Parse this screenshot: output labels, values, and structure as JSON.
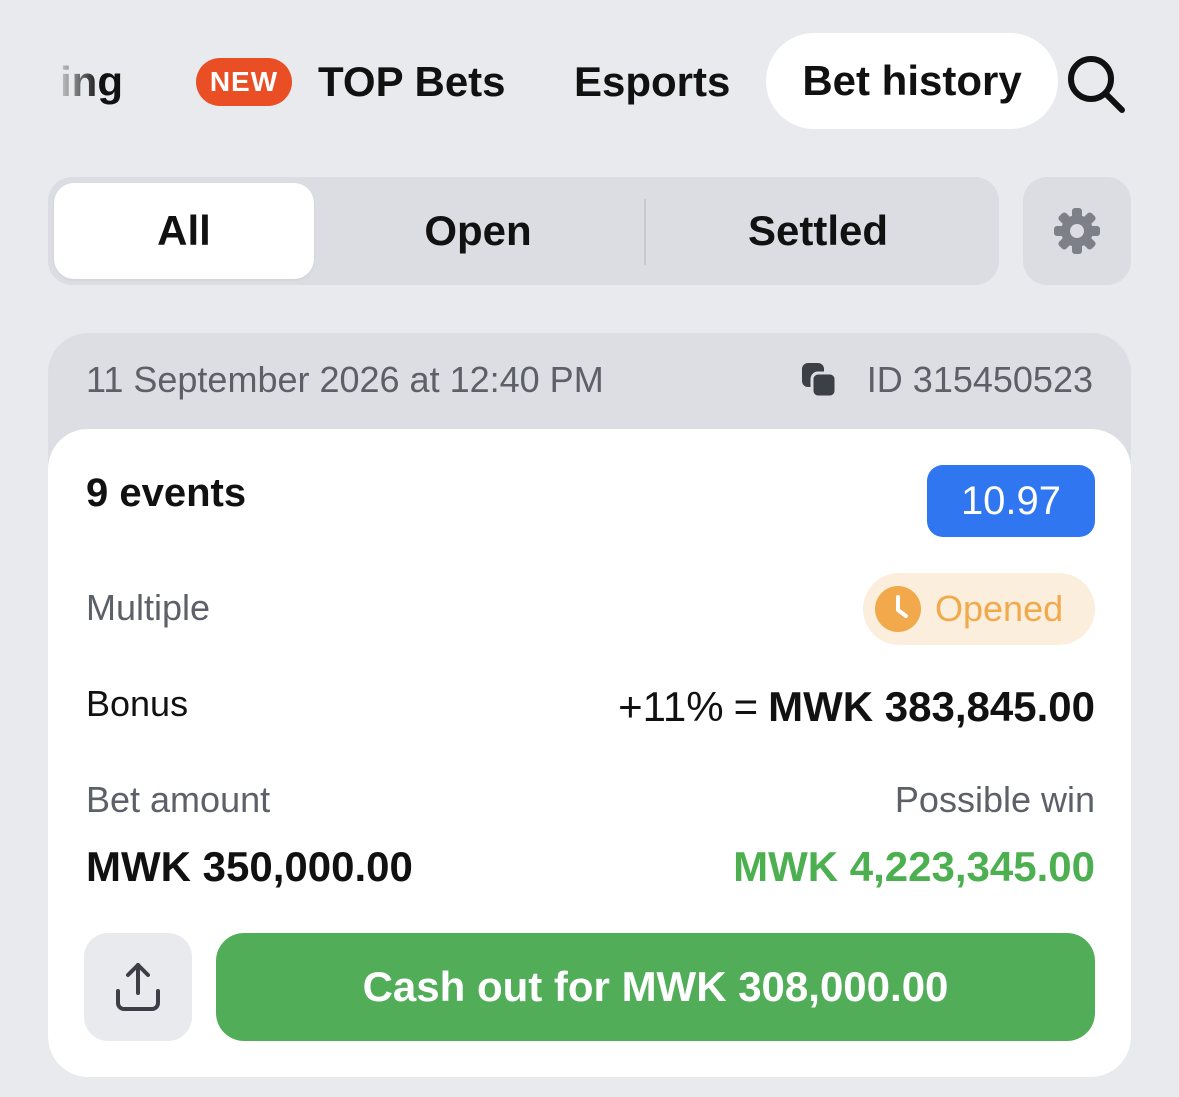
{
  "nav": {
    "partial_label": "ing",
    "new_badge": "NEW",
    "top_bets": "TOP Bets",
    "esports": "Esports",
    "bet_history": "Bet history"
  },
  "filters": {
    "all": "All",
    "open": "Open",
    "settled": "Settled",
    "selected": "All"
  },
  "bet": {
    "date": "11 September 2026 at 12:40 PM",
    "id": "ID 315450523",
    "events": "9 events",
    "odds": "10.97",
    "type": "Multiple",
    "status": "Opened",
    "bonus_label": "Bonus",
    "bonus_percent": "+11%",
    "bonus_equals": "=",
    "bonus_amount": "MWK 383,845.00",
    "bet_amount_label": "Bet amount",
    "bet_amount": "MWK 350,000.00",
    "possible_win_label": "Possible win",
    "possible_win": "MWK 4,223,345.00",
    "cashout_label": "Cash out for MWK 308,000.00"
  },
  "colors": {
    "background": "#e9eaee",
    "new_badge": "#e94e24",
    "odds_badge": "#2f76f0",
    "status_text": "#f1a94b",
    "status_bg": "#fbeedd",
    "possible_win": "#4caf50",
    "cashout_button": "#52ad58"
  },
  "icons": [
    "search-icon",
    "gear-icon",
    "copy-icon",
    "clock-icon",
    "share-icon"
  ]
}
